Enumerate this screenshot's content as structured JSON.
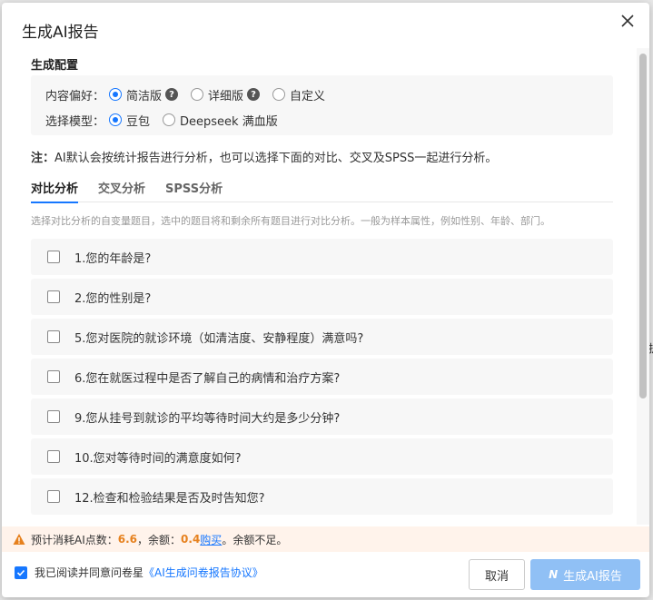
{
  "dialog": {
    "title": "生成AI报告",
    "section_title": "生成配置",
    "content_pref": {
      "label": "内容偏好：",
      "options": [
        "简洁版",
        "详细版",
        "自定义"
      ],
      "selected": "简洁版"
    },
    "model": {
      "label": "选择模型：",
      "options": [
        "豆包",
        "Deepseek 满血版"
      ],
      "selected": "豆包"
    },
    "note_prefix": "注：",
    "note_text": "AI默认会按统计报告进行分析，也可以选择下面的对比、交叉及SPSS一起进行分析。",
    "tabs": [
      "对比分析",
      "交叉分析",
      "SPSS分析"
    ],
    "active_tab": "对比分析",
    "hint": "选择对比分析的自变量题目，选中的题目将和剩余所有题目进行对比分析。一般为样本属性，例如性别、年龄、部门。",
    "questions": [
      "1.您的年龄是?",
      "2.您的性别是?",
      "5.您对医院的就诊环境（如清洁度、安静程度）满意吗?",
      "6.您在就医过程中是否了解自己的病情和治疗方案?",
      "9.您从挂号到就诊的平均等待时间大约是多少分钟?",
      "10.您对等待时间的满意度如何?",
      "12.检查和检验结果是否及时告知您?"
    ],
    "warning": {
      "prefix": "预计消耗AI点数：",
      "cost": "6.6",
      "balance_label": "，余额：",
      "balance": "0.4",
      "buy": "购买",
      "suffix": "。余额不足。"
    },
    "agree": {
      "text": "我已阅读并同意问卷星",
      "link": "《AI生成问卷报告协议》",
      "checked": true
    },
    "cancel_label": "取消",
    "generate_label": "生成AI报告"
  },
  "colors": {
    "accent": "#1677ff",
    "warning": "#e6811e",
    "generate_disabled": "#90c0f5"
  }
}
